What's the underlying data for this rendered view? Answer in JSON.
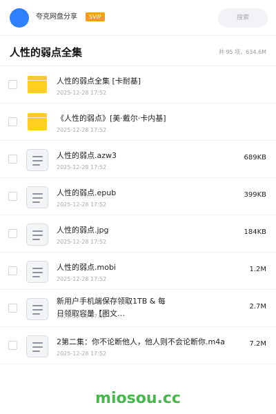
{
  "topbar": {
    "username": "夸克网盘分享",
    "badge": "SVIP",
    "search_label": "搜索"
  },
  "header": {
    "title": "人性的弱点全集",
    "summary": "共 95 项，634.6M"
  },
  "files": [
    {
      "type": "folder",
      "name": "人性的弱点全集 [卡耐基]",
      "date": "2025-12-28 17:52",
      "size": ""
    },
    {
      "type": "folder",
      "name": "《人性的弱点》[美·戴尔·卡内基]",
      "date": "2025-12-28 17:52",
      "size": ""
    },
    {
      "type": "file",
      "name": "人性的弱点.azw3",
      "date": "2025-12-28 17:52",
      "size": "689KB"
    },
    {
      "type": "file",
      "name": "人性的弱点.epub",
      "date": "2025-12-28 17:52",
      "size": "399KB"
    },
    {
      "type": "file",
      "name": "人性的弱点.jpg",
      "date": "2025-12-28 17:52",
      "size": "184KB"
    },
    {
      "type": "file",
      "name": "人性的弱点.mobi",
      "date": "2025-12-28 17:52",
      "size": "1.2M"
    },
    {
      "type": "file",
      "name": "新用户手机端保存领取1TB & 每日领取容量【图文…",
      "date": "2025-12-28 17:52",
      "size": "2.7M"
    },
    {
      "type": "file",
      "name": "2第二集：你不论断他人，他人则不会论断你.m4a",
      "date": "2025-12-28 17:52",
      "size": "7.2M"
    }
  ],
  "watermark": "miosou.cc",
  "colors": {
    "avatar": "#2f80ff",
    "badge": "#f59b23",
    "folder": "#ffcf1f",
    "watermark": "#45b84a"
  }
}
